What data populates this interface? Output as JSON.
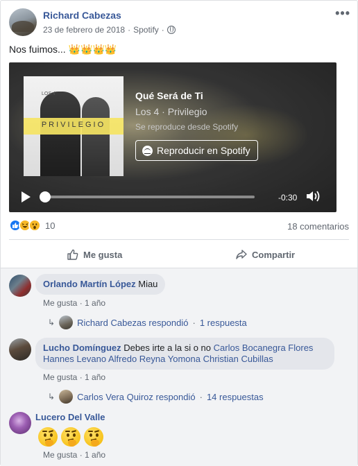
{
  "post": {
    "author": "Richard Cabezas",
    "date": "23 de febrero de 2018",
    "separator": "·",
    "source": "Spotify",
    "text": "Nos fuimos... 👑👑👑👑",
    "more_icon": "•••"
  },
  "embed": {
    "cover_artist": "LOS 4",
    "cover_title": "PRIVILEGIO",
    "track_title": "Qué Será de Ti",
    "artist_album": "Los 4 · Privilegio",
    "source_note": "Se reproduce desde Spotify",
    "button_label": "Reproducir en Spotify",
    "progress": 0.02,
    "time_remaining": "-0:30"
  },
  "reactions": {
    "count": "10",
    "comments_count": "18 comentarios",
    "icons": [
      "like-icon",
      "haha-icon",
      "wow-icon"
    ]
  },
  "actions": {
    "like": "Me gusta",
    "share": "Compartir"
  },
  "comments": [
    {
      "name": "Orlando Martín López",
      "text": " Miau",
      "like": "Me gusta",
      "time": "1 año",
      "reply_author": "Richard Cabezas respondió",
      "reply_count": "1 respuesta"
    },
    {
      "name": "Lucho Domínguez",
      "text": " Debes irte a la si o no ",
      "tags_line1": "Carlos Bocanegra Flores",
      "tags_line2": [
        "Hannes Levano",
        "Alfredo Reyna Yomona",
        "Christian Cubillas"
      ],
      "like": "Me gusta",
      "time": "1 año",
      "reply_author": "Carlos Vera Quiroz respondió",
      "reply_count": "14 respuestas"
    },
    {
      "name": "Lucero Del Valle",
      "emoji_label": "🤔🤔🤔",
      "like": "Me gusta",
      "time": "1 año"
    }
  ],
  "colors": {
    "link": "#385898",
    "meta": "#616770",
    "bubble": "#e4e6eb",
    "comments_bg": "#f2f3f5",
    "like_blue": "#1877f2"
  }
}
